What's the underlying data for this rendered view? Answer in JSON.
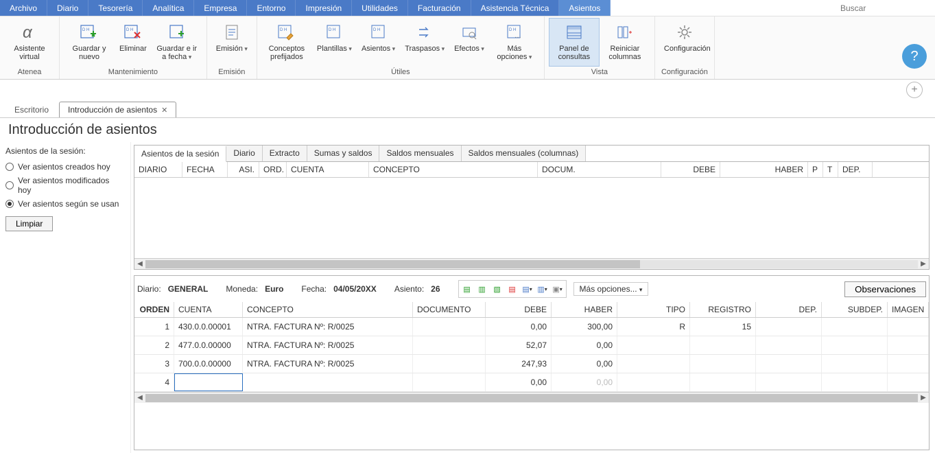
{
  "menubar": {
    "items": [
      "Archivo",
      "Diario",
      "Tesorería",
      "Analítica",
      "Empresa",
      "Entorno",
      "Impresión",
      "Utilidades",
      "Facturación",
      "Asistencia Técnica",
      "Asientos"
    ],
    "active": 10,
    "search_placeholder": "Buscar"
  },
  "ribbon": {
    "groups": [
      {
        "label": "Atenea",
        "buttons": [
          {
            "id": "asistente",
            "label": "Asistente virtual"
          }
        ]
      },
      {
        "label": "Mantenimiento",
        "buttons": [
          {
            "id": "guardar-nuevo",
            "label": "Guardar y nuevo"
          },
          {
            "id": "eliminar",
            "label": "Eliminar"
          },
          {
            "id": "guardar-fecha",
            "label": "Guardar e ir a fecha",
            "dd": true
          }
        ]
      },
      {
        "label": "Emisión",
        "buttons": [
          {
            "id": "emision",
            "label": "Emisión",
            "dd": true
          }
        ]
      },
      {
        "label": "Útiles",
        "buttons": [
          {
            "id": "conceptos",
            "label": "Conceptos prefijados"
          },
          {
            "id": "plantillas",
            "label": "Plantillas",
            "dd": true
          },
          {
            "id": "asientos-u",
            "label": "Asientos",
            "dd": true
          },
          {
            "id": "traspasos",
            "label": "Traspasos",
            "dd": true
          },
          {
            "id": "efectos",
            "label": "Efectos",
            "dd": true
          },
          {
            "id": "mas-opc-r",
            "label": "Más opciones",
            "dd": true
          }
        ]
      },
      {
        "label": "Vista",
        "buttons": [
          {
            "id": "panel-consultas",
            "label": "Panel de consultas",
            "active": true
          },
          {
            "id": "reiniciar-cols",
            "label": "Reiniciar columnas"
          }
        ]
      },
      {
        "label": "Configuración",
        "buttons": [
          {
            "id": "configuracion",
            "label": "Configuración"
          }
        ]
      }
    ]
  },
  "doc_tabs": [
    {
      "label": "Escritorio",
      "closable": false,
      "active": false
    },
    {
      "label": "Introducción de asientos",
      "closable": true,
      "active": true
    }
  ],
  "page_title": "Introducción de asientos",
  "sidebar": {
    "title": "Asientos de la sesión:",
    "options": [
      {
        "label": "Ver asientos creados hoy",
        "checked": false
      },
      {
        "label": "Ver asientos modificados hoy",
        "checked": false
      },
      {
        "label": "Ver asientos según se usan",
        "checked": true
      }
    ],
    "clear_label": "Limpiar"
  },
  "inner_tabs": [
    "Asientos de la sesión",
    "Diario",
    "Extracto",
    "Sumas y saldos",
    "Saldos mensuales",
    "Saldos mensuales (columnas)"
  ],
  "inner_tabs_active": 0,
  "upper_cols": [
    "DIARIO",
    "FECHA",
    "ASI.",
    "ORD.",
    "CUENTA",
    "CONCEPTO",
    "DOCUM.",
    "DEBE",
    "HABER",
    "P",
    "T",
    "DEP."
  ],
  "info": {
    "diario_label": "Diario:",
    "diario_value": "GENERAL",
    "moneda_label": "Moneda:",
    "moneda_value": "Euro",
    "fecha_label": "Fecha:",
    "fecha_value": "04/05/20XX",
    "asiento_label": "Asiento:",
    "asiento_value": "26",
    "mas_opciones": "Más opciones...",
    "observaciones": "Observaciones"
  },
  "lower_cols": [
    "ORDEN",
    "CUENTA",
    "CONCEPTO",
    "DOCUMENTO",
    "DEBE",
    "HABER",
    "TIPO",
    "REGISTRO",
    "DEP.",
    "SUBDEP.",
    "IMAGEN"
  ],
  "rows": [
    {
      "orden": "1",
      "cuenta": "430.0.0.00001",
      "concepto": "NTRA. FACTURA Nº:  R/0025",
      "docum": "",
      "debe": "0,00",
      "haber": "300,00",
      "tipo": "R",
      "reg": "15",
      "dep": "",
      "sub": "",
      "img": ""
    },
    {
      "orden": "2",
      "cuenta": "477.0.0.00000",
      "concepto": "NTRA. FACTURA Nº:  R/0025",
      "docum": "",
      "debe": "52,07",
      "haber": "0,00",
      "tipo": "",
      "reg": "",
      "dep": "",
      "sub": "",
      "img": ""
    },
    {
      "orden": "3",
      "cuenta": "700.0.0.00000",
      "concepto": "NTRA. FACTURA Nº:  R/0025",
      "docum": "",
      "debe": "247,93",
      "haber": "0,00",
      "tipo": "",
      "reg": "",
      "dep": "",
      "sub": "",
      "img": ""
    },
    {
      "orden": "4",
      "cuenta": "",
      "concepto": "",
      "docum": "",
      "debe": "0,00",
      "haber": "0,00",
      "tipo": "",
      "reg": "",
      "dep": "",
      "sub": "",
      "img": "",
      "editing": true,
      "haber_faded": true
    }
  ]
}
